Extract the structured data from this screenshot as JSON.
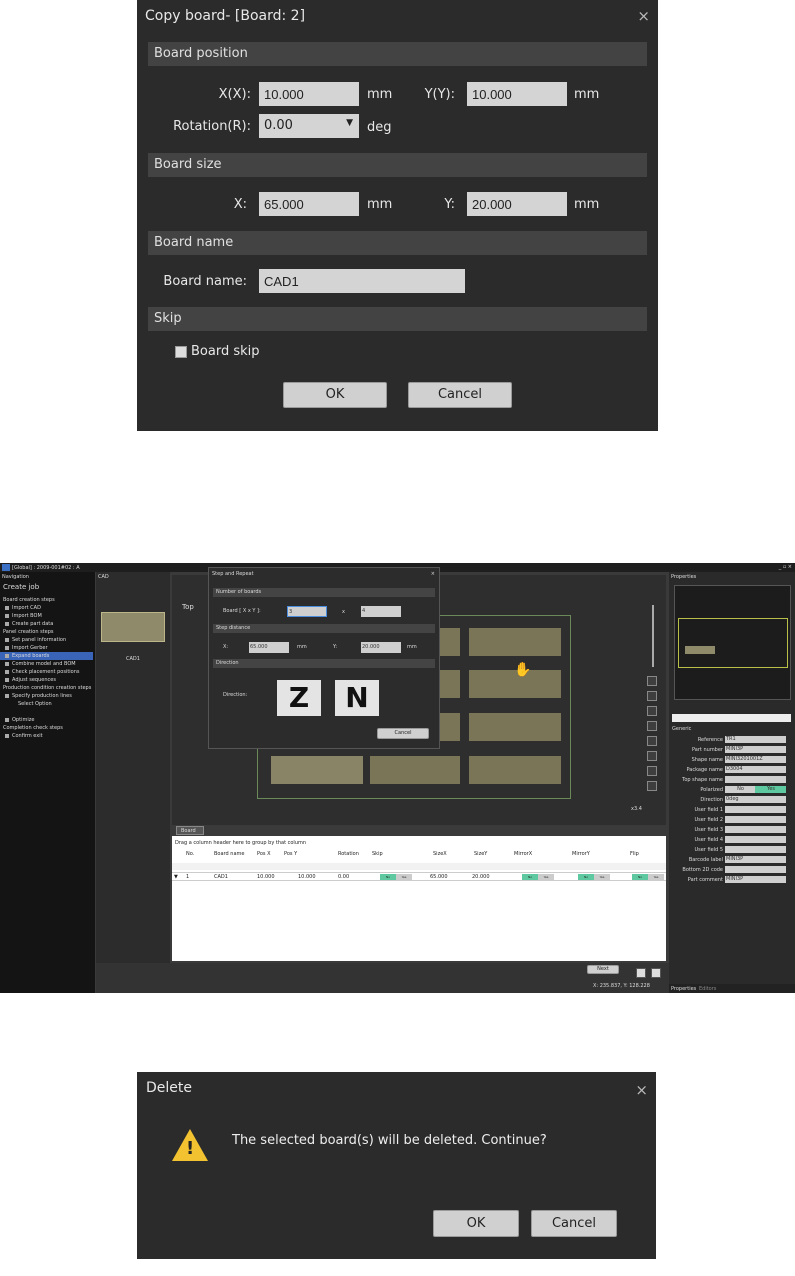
{
  "copy_dialog": {
    "title": "Copy board- [Board: 2]",
    "close": "×",
    "sec_position": "Board position",
    "x_label": "X(X):",
    "x_value": "10.000",
    "y_label": "Y(Y):",
    "y_value": "10.000",
    "unit": "mm",
    "rotation_label": "Rotation(R):",
    "rotation_value": "0.00",
    "deg": "deg",
    "sec_size": "Board size",
    "size_x_label": "X:",
    "size_x_value": "65.000",
    "size_y_label": "Y:",
    "size_y_value": "20.000",
    "sec_name": "Board name",
    "name_label": "Board name:",
    "name_value": "CAD1",
    "sec_skip": "Skip",
    "skip_label": "Board skip",
    "ok": "OK",
    "cancel": "Cancel"
  },
  "main": {
    "title": "[Global] : 2009-001#02 : A",
    "nav_header": "Navigation",
    "nav_title": "Create job",
    "nav": [
      {
        "t": "Board creation steps",
        "h": 1
      },
      {
        "t": "Import CAD"
      },
      {
        "t": "Import BOM"
      },
      {
        "t": "Create part data"
      },
      {
        "t": "Panel creation steps",
        "h": 1
      },
      {
        "t": "Set panel information"
      },
      {
        "t": "Import Gerber"
      },
      {
        "t": "Expand boards",
        "sel": 1
      },
      {
        "t": "Combine model and BOM"
      },
      {
        "t": "Check placement positions"
      },
      {
        "t": "Adjust sequences"
      },
      {
        "t": "Production condition creation steps",
        "h": 1
      },
      {
        "t": "Specify production lines"
      },
      {
        "t": "Select Option",
        "sub": 1
      },
      {
        "t": ""
      },
      {
        "t": "Optimize"
      },
      {
        "t": "Completion check steps",
        "h": 1
      },
      {
        "t": "Confirm exit"
      }
    ],
    "cad_header": "CAD",
    "cad_name": "CAD1",
    "top_label": "Top",
    "zoom": "x3.4",
    "step": {
      "title": "Step and Repeat",
      "close": "×",
      "sec_boards": "Number of boards",
      "board_label": "Board [ X x Y ]:",
      "bx": "3",
      "times": "x",
      "by": "4",
      "sec_dist": "Step distance",
      "x_label": "X:",
      "x_value": "65.000",
      "unit": "mm",
      "y_label": "Y:",
      "y_value": "20.000",
      "sec_dir": "Direction",
      "dir_label": "Direction:",
      "cancel": "Cancel"
    },
    "board_tab": "Board",
    "group_hint": "Drag a column header here to group by that column",
    "columns": [
      "No.",
      "Board name",
      "Pos X",
      "Pos Y",
      "Rotation",
      "Skip",
      "SizeX",
      "SizeY",
      "MirrorX",
      "MirrorY",
      "Flip"
    ],
    "row": [
      "1",
      "CAD1",
      "10.000",
      "10.000",
      "0.00",
      "65.000",
      "20.000"
    ],
    "no": "No",
    "yes": "Yes",
    "next": "Next",
    "coords": "X: 235.837, Y: 128.228",
    "prop_header": "Properties",
    "generic": "Generic",
    "props": [
      [
        "Reference",
        "TR1"
      ],
      [
        "Part number",
        "MINI3P"
      ],
      [
        "Shape name",
        "MINI3201001Z"
      ],
      [
        "Package name",
        "D3004"
      ],
      [
        "Top shape name",
        ""
      ],
      [
        "Polarized",
        ""
      ],
      [
        "Direction",
        "0deg"
      ],
      [
        "User field 1",
        ""
      ],
      [
        "User field 2",
        ""
      ],
      [
        "User field 3",
        ""
      ],
      [
        "User field 4",
        ""
      ],
      [
        "User field 5",
        ""
      ],
      [
        "Barcode label",
        "MINI3P"
      ],
      [
        "Bottom 2D code",
        ""
      ],
      [
        "Part comment",
        "MINI3P"
      ]
    ],
    "tabs": [
      "Properties",
      "Editors"
    ]
  },
  "delete_dialog": {
    "title": "Delete",
    "close": "×",
    "message": "The selected board(s) will be deleted. Continue?",
    "ok": "OK",
    "cancel": "Cancel"
  },
  "colors": {
    "dialog_bg": "#2b2b2b",
    "section": "#434343",
    "field": "#d4d4d4",
    "toggle_on": "#5ec8a0",
    "board": "#7a7556"
  }
}
